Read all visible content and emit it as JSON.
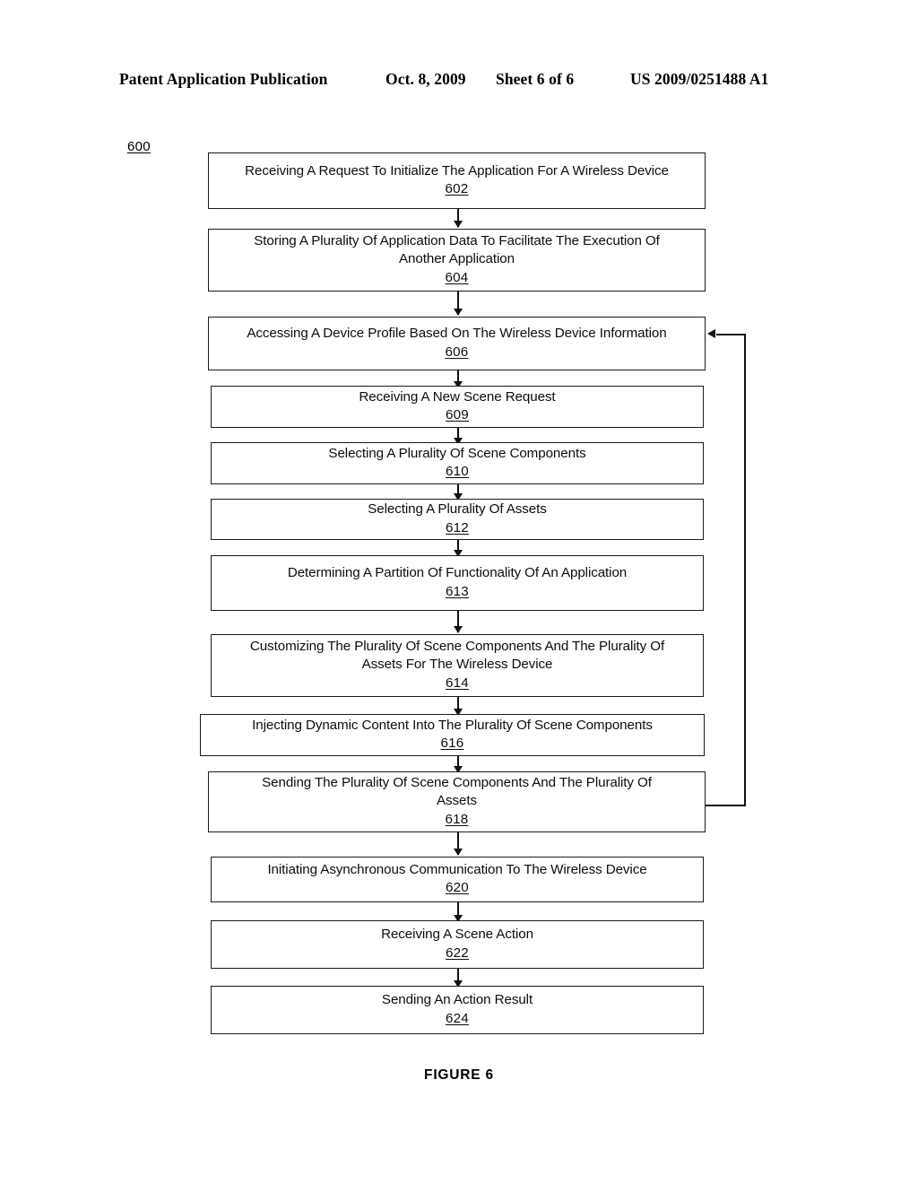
{
  "header": {
    "publication": "Patent Application Publication",
    "date": "Oct. 8, 2009",
    "sheet": "Sheet 6 of 6",
    "document_number": "US 2009/0251488 A1"
  },
  "figure": {
    "reference_number": "600",
    "caption": "FIGURE 6"
  },
  "flowchart": {
    "nodes": [
      {
        "id": "n602",
        "label": "Receiving A Request To Initialize The Application For A Wireless Device",
        "ref": "602"
      },
      {
        "id": "n604",
        "label": "Storing A Plurality Of Application Data To Facilitate The Execution Of\nAnother Application",
        "ref": "604"
      },
      {
        "id": "n606",
        "label": "Accessing A Device Profile Based On The Wireless Device Information",
        "ref": "606"
      },
      {
        "id": "n609",
        "label": "Receiving A New Scene Request",
        "ref": "609"
      },
      {
        "id": "n610",
        "label": "Selecting A Plurality Of Scene Components",
        "ref": "610"
      },
      {
        "id": "n612",
        "label": "Selecting A Plurality Of Assets",
        "ref": "612"
      },
      {
        "id": "n613",
        "label": "Determining A Partition Of Functionality Of An Application",
        "ref": "613"
      },
      {
        "id": "n614",
        "label": "Customizing The Plurality Of Scene Components And The Plurality Of\nAssets For The Wireless Device",
        "ref": "614"
      },
      {
        "id": "n616",
        "label": "Injecting Dynamic Content Into The Plurality Of Scene Components",
        "ref": "616"
      },
      {
        "id": "n618",
        "label": "Sending The Plurality Of Scene Components And The Plurality Of\nAssets",
        "ref": "618"
      },
      {
        "id": "n620",
        "label": "Initiating Asynchronous Communication To The Wireless Device",
        "ref": "620"
      },
      {
        "id": "n622",
        "label": "Receiving A Scene Action",
        "ref": "622"
      },
      {
        "id": "n624",
        "label": "Sending An Action Result",
        "ref": "624"
      }
    ],
    "connections": [
      {
        "from": "602",
        "to": "604",
        "kind": "down-arrow"
      },
      {
        "from": "604",
        "to": "606",
        "kind": "down-arrow"
      },
      {
        "from": "606",
        "to": "609",
        "kind": "down-arrow"
      },
      {
        "from": "609",
        "to": "610",
        "kind": "down-arrow"
      },
      {
        "from": "610",
        "to": "612",
        "kind": "down-arrow"
      },
      {
        "from": "612",
        "to": "613",
        "kind": "down-arrow"
      },
      {
        "from": "613",
        "to": "614",
        "kind": "down-arrow"
      },
      {
        "from": "614",
        "to": "616",
        "kind": "down-arrow"
      },
      {
        "from": "616",
        "to": "618",
        "kind": "down-arrow"
      },
      {
        "from": "618",
        "to": "620",
        "kind": "down-arrow"
      },
      {
        "from": "620",
        "to": "622",
        "kind": "down-arrow"
      },
      {
        "from": "622",
        "to": "624",
        "kind": "down-arrow"
      },
      {
        "from": "618",
        "to": "606",
        "kind": "feedback-right-loop"
      }
    ]
  },
  "colors": {
    "ink": "#111111",
    "page_background": "#ffffff"
  }
}
